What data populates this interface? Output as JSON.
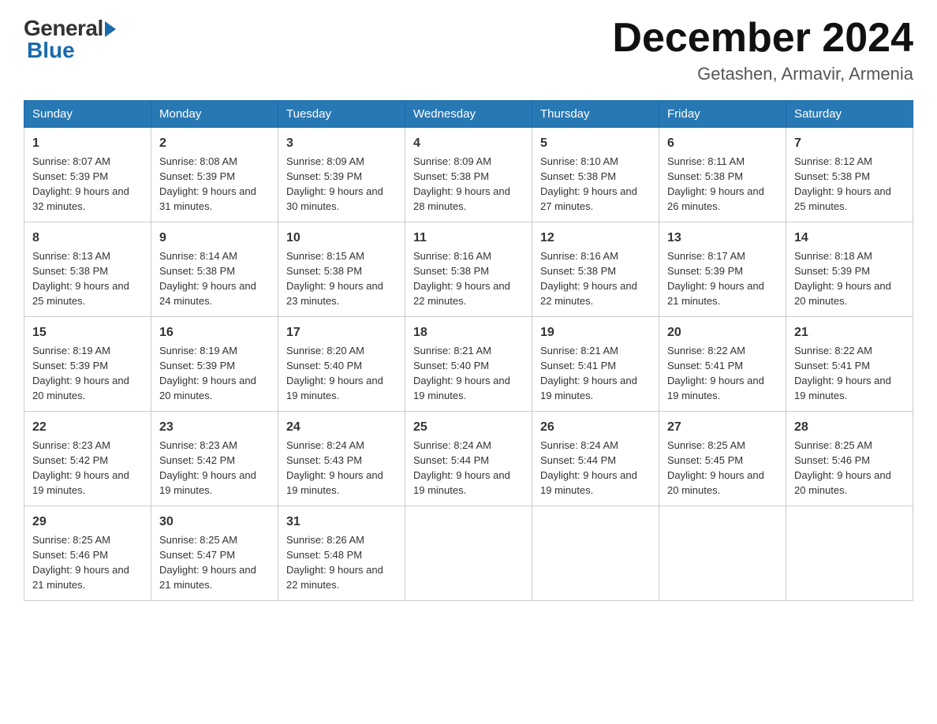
{
  "logo": {
    "general": "General",
    "blue": "Blue"
  },
  "title": "December 2024",
  "location": "Getashen, Armavir, Armenia",
  "days_of_week": [
    "Sunday",
    "Monday",
    "Tuesday",
    "Wednesday",
    "Thursday",
    "Friday",
    "Saturday"
  ],
  "weeks": [
    [
      {
        "day": "1",
        "sunrise": "8:07 AM",
        "sunset": "5:39 PM",
        "daylight": "9 hours and 32 minutes."
      },
      {
        "day": "2",
        "sunrise": "8:08 AM",
        "sunset": "5:39 PM",
        "daylight": "9 hours and 31 minutes."
      },
      {
        "day": "3",
        "sunrise": "8:09 AM",
        "sunset": "5:39 PM",
        "daylight": "9 hours and 30 minutes."
      },
      {
        "day": "4",
        "sunrise": "8:09 AM",
        "sunset": "5:38 PM",
        "daylight": "9 hours and 28 minutes."
      },
      {
        "day": "5",
        "sunrise": "8:10 AM",
        "sunset": "5:38 PM",
        "daylight": "9 hours and 27 minutes."
      },
      {
        "day": "6",
        "sunrise": "8:11 AM",
        "sunset": "5:38 PM",
        "daylight": "9 hours and 26 minutes."
      },
      {
        "day": "7",
        "sunrise": "8:12 AM",
        "sunset": "5:38 PM",
        "daylight": "9 hours and 25 minutes."
      }
    ],
    [
      {
        "day": "8",
        "sunrise": "8:13 AM",
        "sunset": "5:38 PM",
        "daylight": "9 hours and 25 minutes."
      },
      {
        "day": "9",
        "sunrise": "8:14 AM",
        "sunset": "5:38 PM",
        "daylight": "9 hours and 24 minutes."
      },
      {
        "day": "10",
        "sunrise": "8:15 AM",
        "sunset": "5:38 PM",
        "daylight": "9 hours and 23 minutes."
      },
      {
        "day": "11",
        "sunrise": "8:16 AM",
        "sunset": "5:38 PM",
        "daylight": "9 hours and 22 minutes."
      },
      {
        "day": "12",
        "sunrise": "8:16 AM",
        "sunset": "5:38 PM",
        "daylight": "9 hours and 22 minutes."
      },
      {
        "day": "13",
        "sunrise": "8:17 AM",
        "sunset": "5:39 PM",
        "daylight": "9 hours and 21 minutes."
      },
      {
        "day": "14",
        "sunrise": "8:18 AM",
        "sunset": "5:39 PM",
        "daylight": "9 hours and 20 minutes."
      }
    ],
    [
      {
        "day": "15",
        "sunrise": "8:19 AM",
        "sunset": "5:39 PM",
        "daylight": "9 hours and 20 minutes."
      },
      {
        "day": "16",
        "sunrise": "8:19 AM",
        "sunset": "5:39 PM",
        "daylight": "9 hours and 20 minutes."
      },
      {
        "day": "17",
        "sunrise": "8:20 AM",
        "sunset": "5:40 PM",
        "daylight": "9 hours and 19 minutes."
      },
      {
        "day": "18",
        "sunrise": "8:21 AM",
        "sunset": "5:40 PM",
        "daylight": "9 hours and 19 minutes."
      },
      {
        "day": "19",
        "sunrise": "8:21 AM",
        "sunset": "5:41 PM",
        "daylight": "9 hours and 19 minutes."
      },
      {
        "day": "20",
        "sunrise": "8:22 AM",
        "sunset": "5:41 PM",
        "daylight": "9 hours and 19 minutes."
      },
      {
        "day": "21",
        "sunrise": "8:22 AM",
        "sunset": "5:41 PM",
        "daylight": "9 hours and 19 minutes."
      }
    ],
    [
      {
        "day": "22",
        "sunrise": "8:23 AM",
        "sunset": "5:42 PM",
        "daylight": "9 hours and 19 minutes."
      },
      {
        "day": "23",
        "sunrise": "8:23 AM",
        "sunset": "5:42 PM",
        "daylight": "9 hours and 19 minutes."
      },
      {
        "day": "24",
        "sunrise": "8:24 AM",
        "sunset": "5:43 PM",
        "daylight": "9 hours and 19 minutes."
      },
      {
        "day": "25",
        "sunrise": "8:24 AM",
        "sunset": "5:44 PM",
        "daylight": "9 hours and 19 minutes."
      },
      {
        "day": "26",
        "sunrise": "8:24 AM",
        "sunset": "5:44 PM",
        "daylight": "9 hours and 19 minutes."
      },
      {
        "day": "27",
        "sunrise": "8:25 AM",
        "sunset": "5:45 PM",
        "daylight": "9 hours and 20 minutes."
      },
      {
        "day": "28",
        "sunrise": "8:25 AM",
        "sunset": "5:46 PM",
        "daylight": "9 hours and 20 minutes."
      }
    ],
    [
      {
        "day": "29",
        "sunrise": "8:25 AM",
        "sunset": "5:46 PM",
        "daylight": "9 hours and 21 minutes."
      },
      {
        "day": "30",
        "sunrise": "8:25 AM",
        "sunset": "5:47 PM",
        "daylight": "9 hours and 21 minutes."
      },
      {
        "day": "31",
        "sunrise": "8:26 AM",
        "sunset": "5:48 PM",
        "daylight": "9 hours and 22 minutes."
      },
      null,
      null,
      null,
      null
    ]
  ]
}
